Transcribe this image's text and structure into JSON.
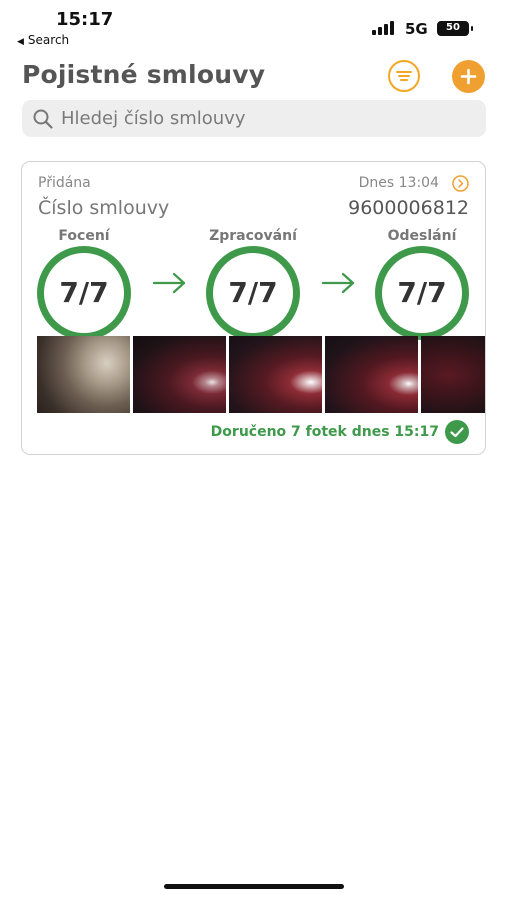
{
  "status_bar": {
    "time": "15:17",
    "back_label": "Search",
    "network": "5G",
    "battery": "50"
  },
  "header": {
    "title": "Pojistné smlouvy",
    "filter_icon": "filter-lines-icon",
    "add_icon": "plus-icon"
  },
  "search": {
    "placeholder": "Hledej číslo smlouvy"
  },
  "card": {
    "status": "Přidána",
    "date": "Dnes 13:04",
    "label": "Číslo smlouvy",
    "number": "9600006812",
    "stages": [
      {
        "label": "Focení",
        "value": "7/7"
      },
      {
        "label": "Zpracování",
        "value": "7/7"
      },
      {
        "label": "Odeslání",
        "value": "7/7"
      }
    ],
    "photo_count_visible": 5,
    "delivered": "Doručeno 7 fotek dnes 15:17"
  },
  "colors": {
    "accent": "#f5a623",
    "success": "#3e9a4a",
    "title": "#555555"
  }
}
